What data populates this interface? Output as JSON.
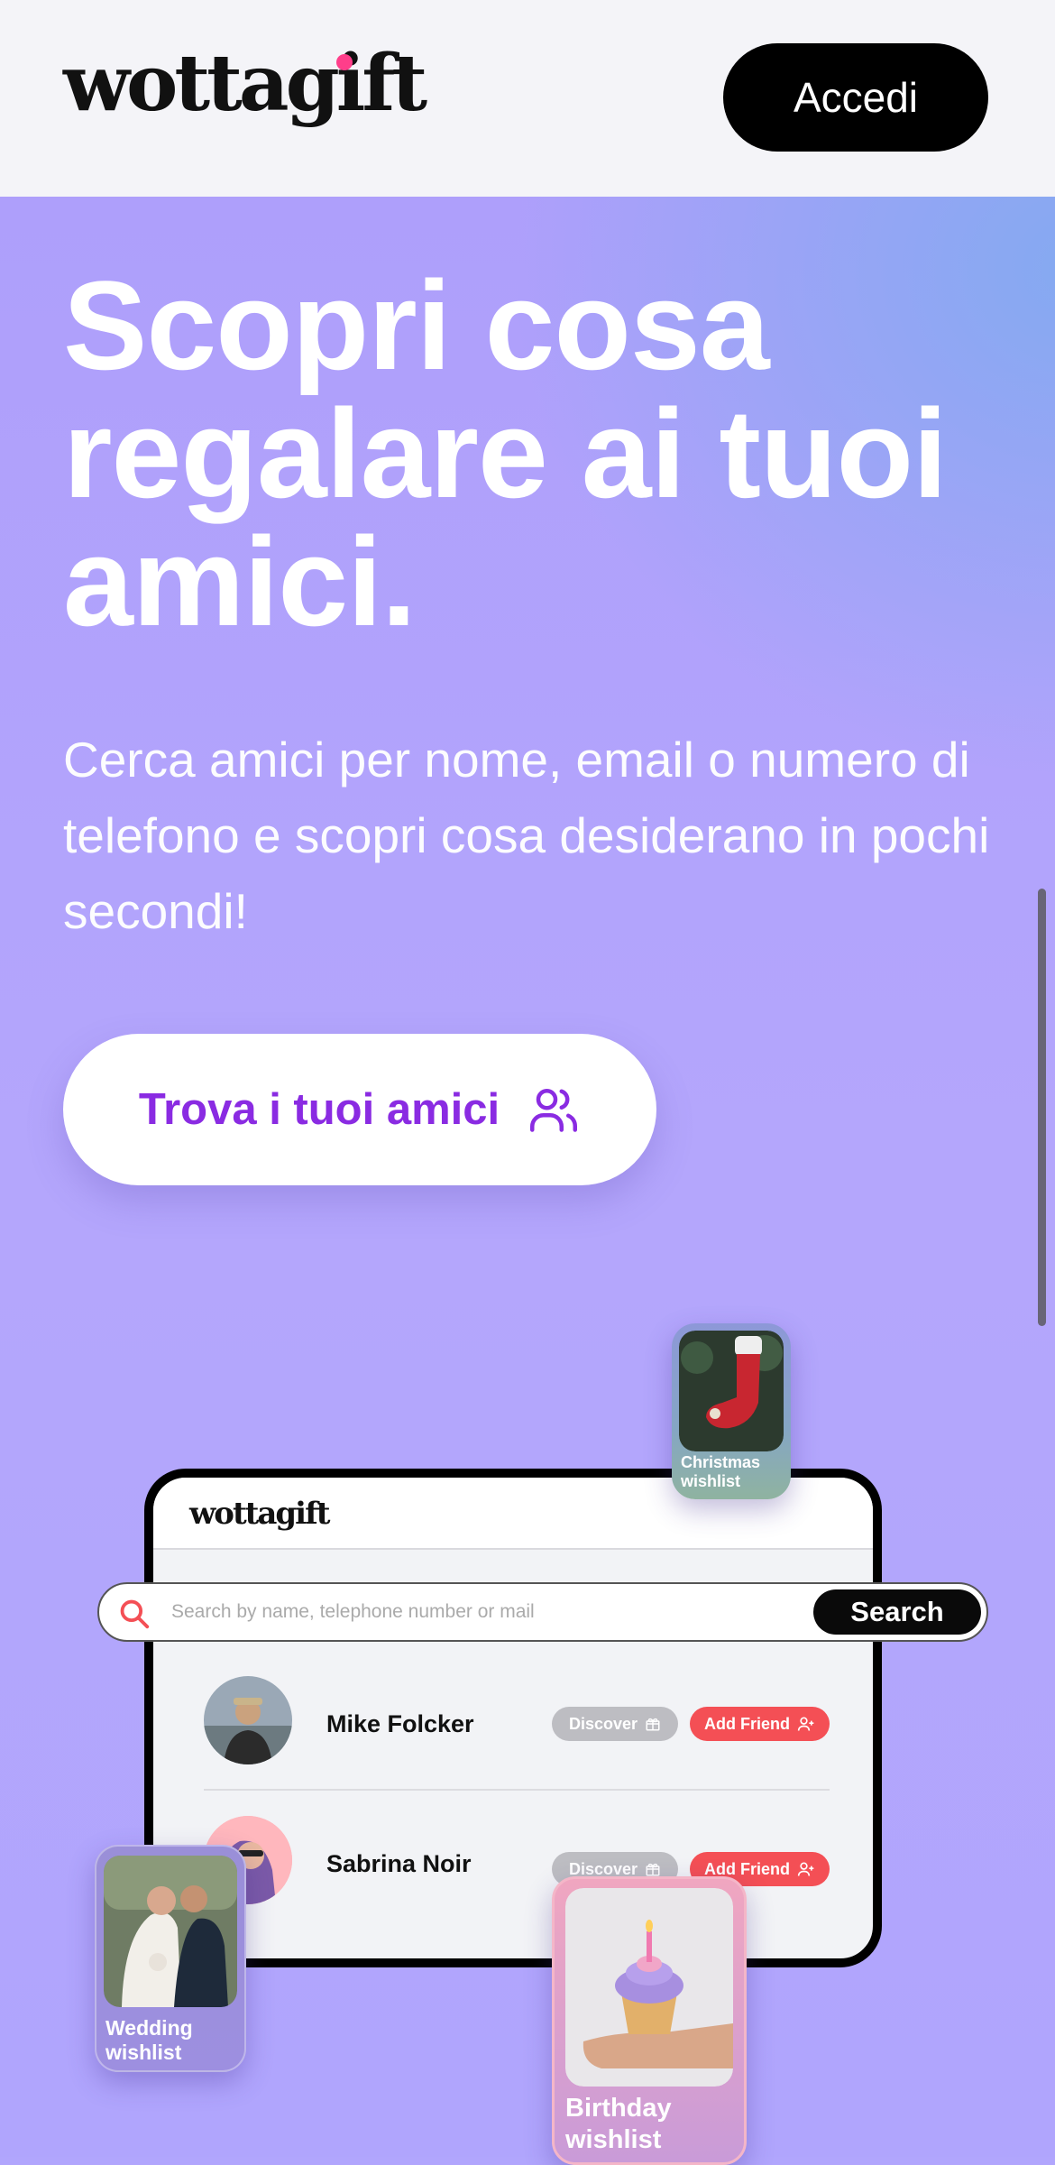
{
  "header": {
    "logo": "wottagift",
    "login_label": "Accedi"
  },
  "hero": {
    "headline": "Scopri cosa regalare ai tuoi amici.",
    "subtitle": "Cerca amici per nome, email o numero di telefono e scopri cosa desiderano in pochi secondi!",
    "cta_label": "Trova i tuoi amici",
    "cta_icon": "users-icon"
  },
  "mockup": {
    "logo": "wottagift",
    "search_placeholder": "Search by name, telephone number or mail",
    "search_label": "Search",
    "rows": [
      {
        "name": "Mike Folcker",
        "discover": "Discover",
        "add": "Add Friend"
      },
      {
        "name": "Sabrina Noir",
        "discover": "Discover",
        "add": "Add Friend"
      }
    ],
    "cards": {
      "christmas": "Christmas wishlist",
      "wedding": "Wedding wishlist",
      "birthday": "Birthday wishlist"
    }
  },
  "colors": {
    "accent_purple": "#8a2be2",
    "brand_pink": "#ff3e8a",
    "add_red": "#f44f55"
  }
}
